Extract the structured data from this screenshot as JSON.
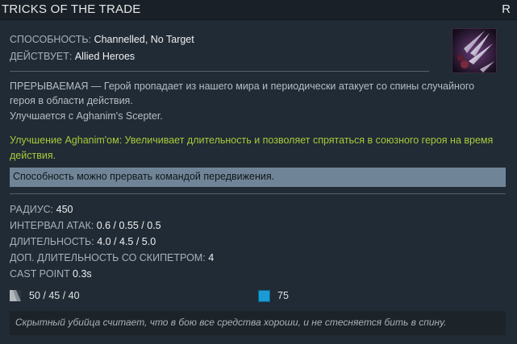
{
  "header": {
    "title": "TRICKS OF THE TRADE",
    "hotkey": "R"
  },
  "ability": {
    "type_label": "СПОСОБНОСТЬ:",
    "type_value": "Channelled, No Target",
    "affects_label": "ДЕЙСТВУЕТ:",
    "affects_value": "Allied Heroes"
  },
  "description": {
    "main": "ПРЕРЫВАЕМАЯ — Герой пропадает из нашего мира и периодически атакует со спины случайного героя в области действия.",
    "upgrade_line": "Улучшается с Aghanim's Scepter.",
    "aghanim": "Улучшение Aghanim'ом: Увеличивает длительность и позволяет спрятаться в союзного героя на время действия."
  },
  "note": "Способность можно прервать командой передвижения.",
  "stats": [
    {
      "label": "РАДИУС:",
      "value": "450"
    },
    {
      "label": "ИНТЕРВАЛ АТАК:",
      "value": "0.6 / 0.55 / 0.5"
    },
    {
      "label": "ДЛИТЕЛЬНОСТЬ:",
      "value": "4.0 / 4.5 / 5.0"
    },
    {
      "label": "ДОП. ДЛИТЕЛЬНОСТЬ СО СКИПЕТРОМ:",
      "value": "4"
    },
    {
      "label": "CAST POINT",
      "value": "0.3s"
    }
  ],
  "costs": {
    "cooldown": "50 / 45 / 40",
    "mana": "75"
  },
  "lore": "Скрытный убийца считает, что в бою все средства хороши, и не стесняется бить в спину.",
  "colors": {
    "aghanim_text": "#a7c93a",
    "mana": "#1a9bd6",
    "note_bg": "#6f8597"
  },
  "icons": {
    "ability": "tricks-of-the-trade-icon",
    "cooldown": "cooldown-icon",
    "mana": "mana-icon"
  }
}
